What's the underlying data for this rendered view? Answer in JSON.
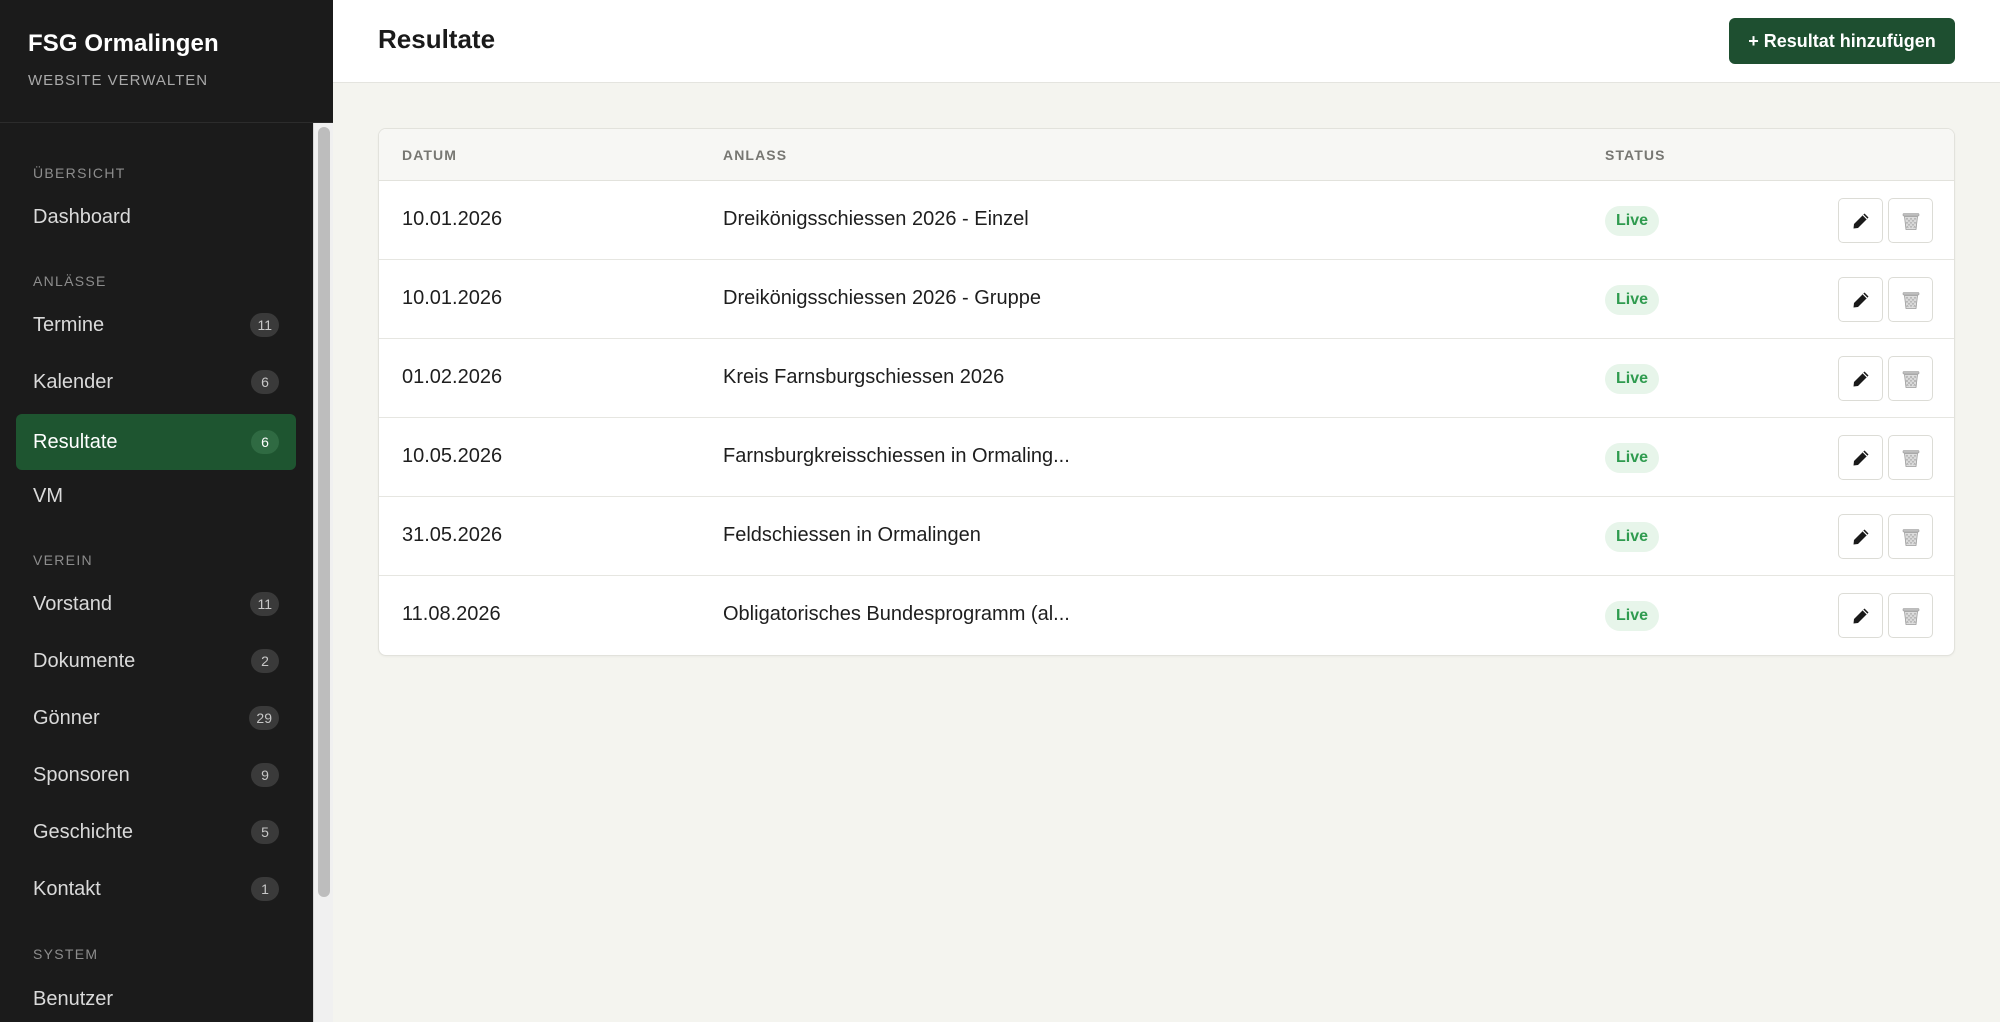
{
  "brand": {
    "title": "FSG Ormalingen",
    "subtitle": "WEBSITE VERWALTEN"
  },
  "nav": {
    "sections": [
      {
        "label": "ÜBERSICHT",
        "items": [
          {
            "label": "Dashboard",
            "badge": ""
          }
        ]
      },
      {
        "label": "ANLÄSSE",
        "items": [
          {
            "label": "Termine",
            "badge": "11"
          },
          {
            "label": "Kalender",
            "badge": "6"
          },
          {
            "label": "Resultate",
            "badge": "6",
            "active": true
          },
          {
            "label": "VM",
            "badge": ""
          }
        ]
      },
      {
        "label": "VEREIN",
        "items": [
          {
            "label": "Vorstand",
            "badge": "11"
          },
          {
            "label": "Dokumente",
            "badge": "2"
          },
          {
            "label": "Gönner",
            "badge": "29"
          },
          {
            "label": "Sponsoren",
            "badge": "9"
          },
          {
            "label": "Geschichte",
            "badge": "5"
          },
          {
            "label": "Kontakt",
            "badge": "1"
          }
        ]
      },
      {
        "label": "SYSTEM",
        "items": [
          {
            "label": "Benutzer",
            "badge": ""
          }
        ]
      }
    ]
  },
  "header": {
    "title": "Resultate",
    "add_label": "+ Resultat hinzufügen"
  },
  "table": {
    "columns": {
      "date": "DATUM",
      "event": "ANLASS",
      "status": "STATUS"
    },
    "rows": [
      {
        "date": "10.01.2026",
        "event": "Dreikönigsschiessen 2026 - Einzel",
        "status": "Live"
      },
      {
        "date": "10.01.2026",
        "event": "Dreikönigsschiessen 2026 - Gruppe",
        "status": "Live"
      },
      {
        "date": "01.02.2026",
        "event": "Kreis Farnsburgschiessen 2026",
        "status": "Live"
      },
      {
        "date": "10.05.2026",
        "event": "Farnsburgkreisschiessen in Ormaling...",
        "status": "Live"
      },
      {
        "date": "31.05.2026",
        "event": "Feldschiessen in Ormalingen",
        "status": "Live"
      },
      {
        "date": "11.08.2026",
        "event": "Obligatorisches Bundesprogramm (al...",
        "status": "Live"
      }
    ]
  },
  "icons": {
    "edit": "pencil-icon",
    "delete": "trash-icon"
  },
  "colors": {
    "sidebar_bg": "#1b1b1b",
    "accent": "#1e5530",
    "button": "#1e4f30",
    "status_text": "#2f9b4f",
    "status_bg": "#e7f5ea"
  }
}
